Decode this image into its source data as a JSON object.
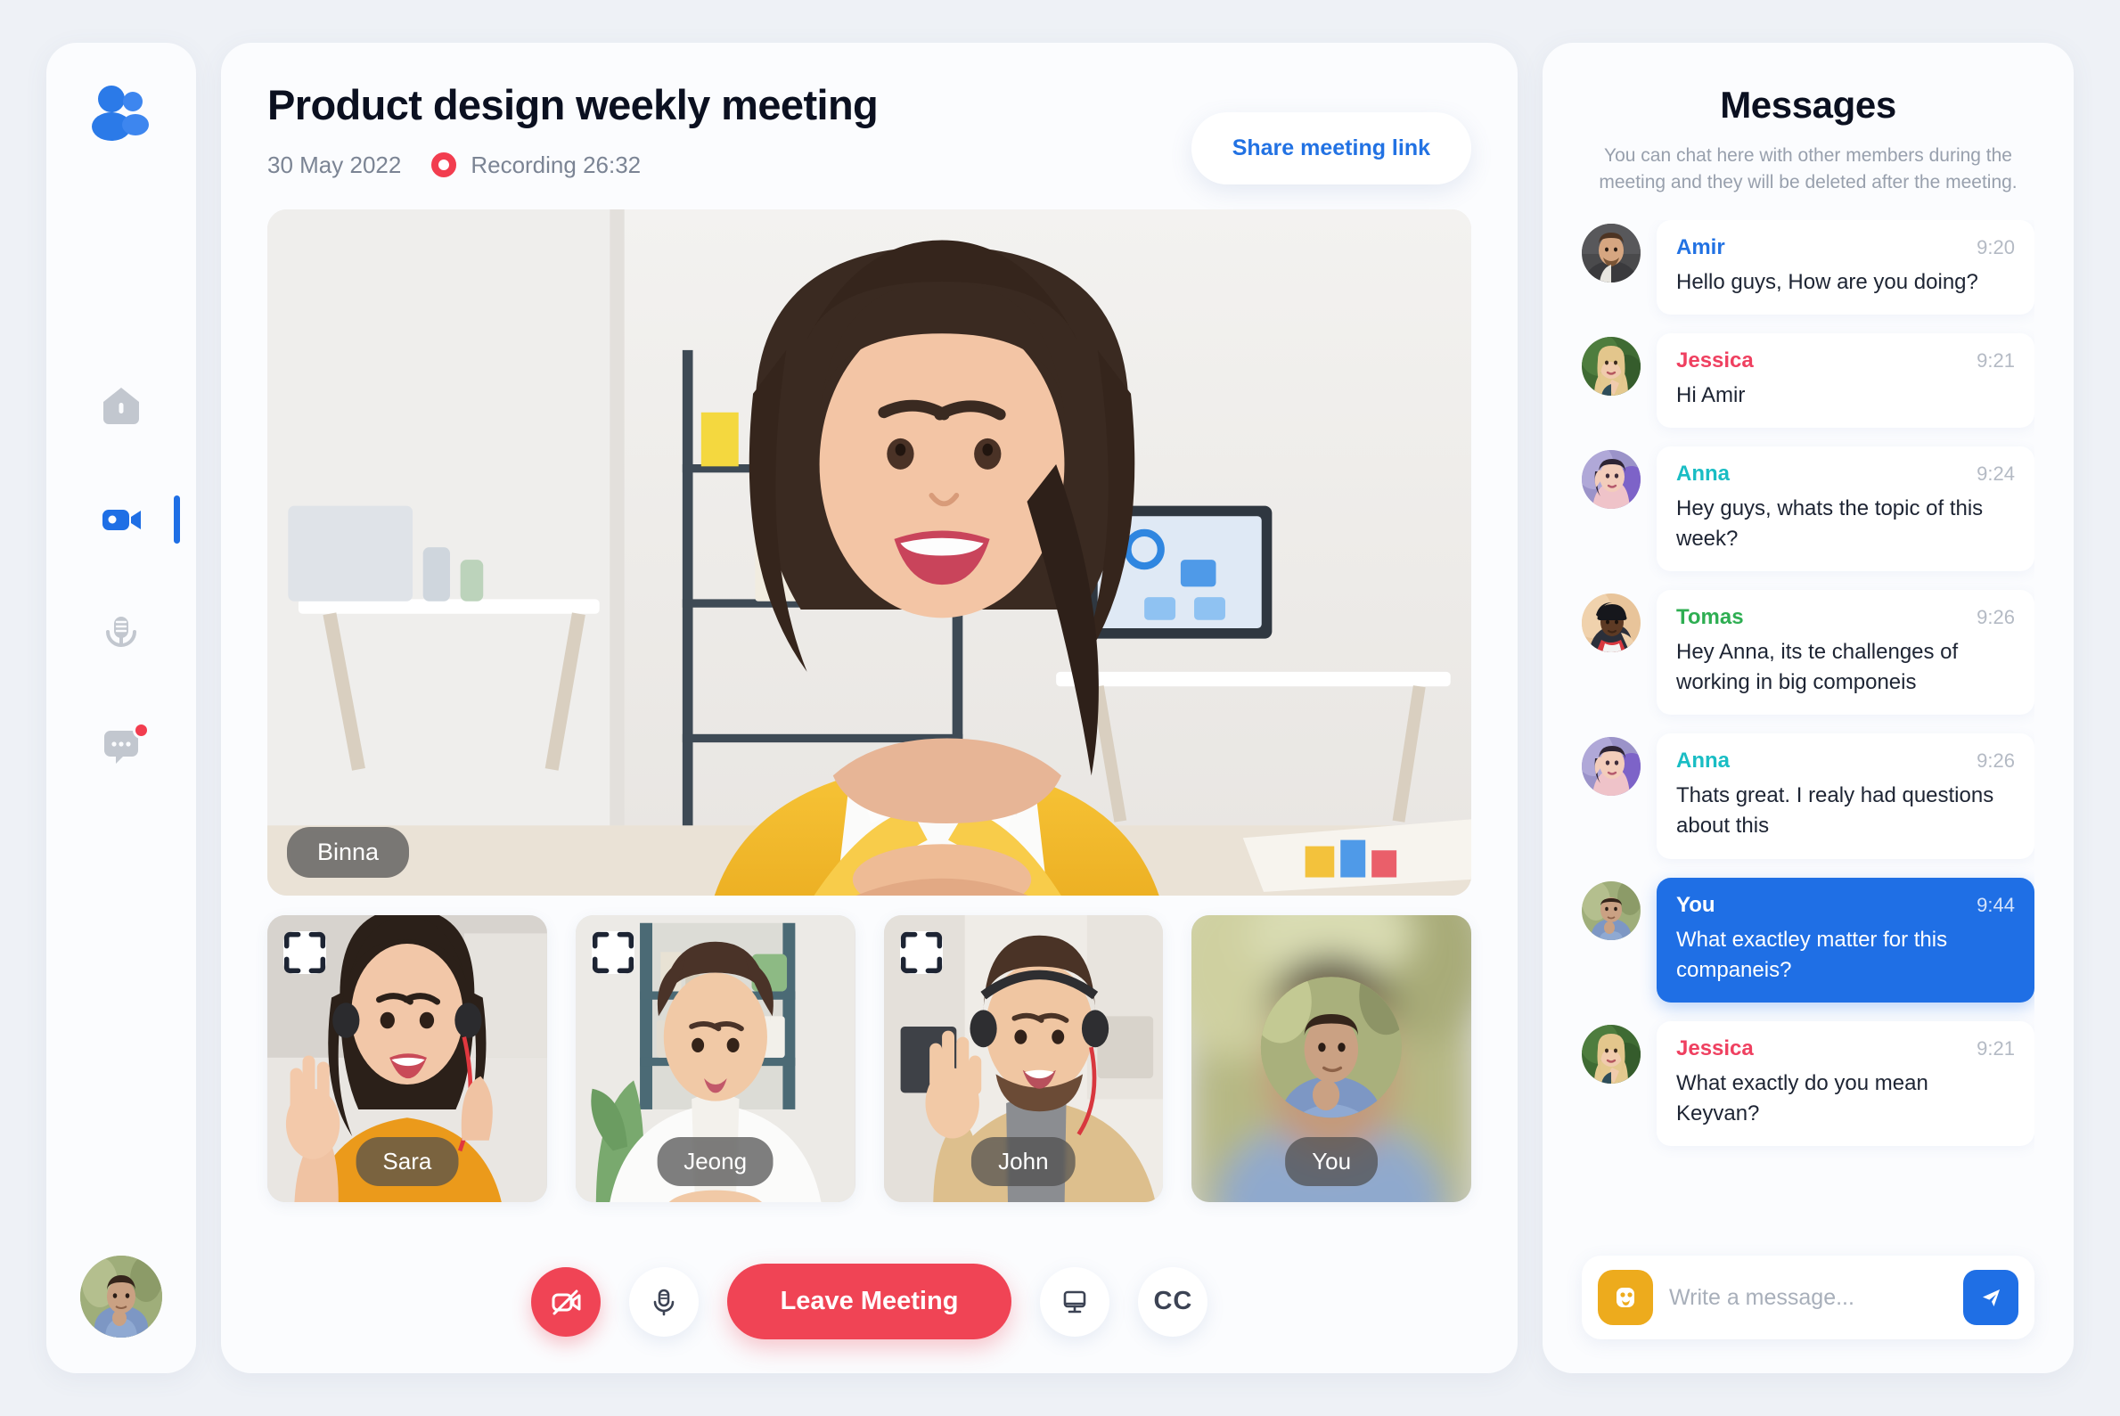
{
  "sidebar": {
    "logo_icon": "people-group-icon",
    "items": [
      {
        "icon": "home-icon",
        "name": "home",
        "active": false,
        "badge": false
      },
      {
        "icon": "video-camera-icon",
        "name": "meetings",
        "active": true,
        "badge": false
      },
      {
        "icon": "microphone-icon",
        "name": "audio",
        "active": false,
        "badge": false
      },
      {
        "icon": "chat-bubble-icon",
        "name": "messages",
        "active": false,
        "badge": true
      }
    ],
    "avatar": {
      "name": "user-avatar"
    }
  },
  "meeting": {
    "title": "Product design weekly meeting",
    "date": "30 May 2022",
    "recording_label": "Recording 26:32",
    "recording_icon": "record-dot-icon",
    "share_label": "Share meeting link",
    "stage": {
      "speaker": "Binna"
    },
    "participants": [
      {
        "name": "Sara",
        "expandable": true,
        "camera_on": true
      },
      {
        "name": "Jeong",
        "expandable": true,
        "camera_on": true
      },
      {
        "name": "John",
        "expandable": true,
        "camera_on": true
      },
      {
        "name": "You",
        "expandable": false,
        "camera_on": false
      }
    ],
    "controls": {
      "camera": {
        "icon": "camera-off-icon",
        "state": "off"
      },
      "mic": {
        "icon": "microphone-icon",
        "state": "on"
      },
      "leave_label": "Leave Meeting",
      "screen": {
        "icon": "screen-share-icon"
      },
      "captions_label": "CC"
    }
  },
  "chat": {
    "title": "Messages",
    "subtitle": "You can chat here with other members during the meeting and they will be deleted after the meeting.",
    "messages": [
      {
        "sender": "Amir",
        "time": "9:20",
        "text": "Hello guys, How are you doing?",
        "self": false,
        "color": "#2272e3"
      },
      {
        "sender": "Jessica",
        "time": "9:21",
        "text": "Hi Amir",
        "self": false,
        "color": "#ef4060"
      },
      {
        "sender": "Anna",
        "time": "9:24",
        "text": "Hey guys, whats the topic of this week?",
        "self": false,
        "color": "#19bdc4"
      },
      {
        "sender": "Tomas",
        "time": "9:26",
        "text": "Hey Anna, its te challenges of working in big componeis",
        "self": false,
        "color": "#2eae52"
      },
      {
        "sender": "Anna",
        "time": "9:26",
        "text": "Thats great. I realy had questions about this",
        "self": false,
        "color": "#19bdc4"
      },
      {
        "sender": "You",
        "time": "9:44",
        "text": "What exactley matter for this companeis?",
        "self": true,
        "color": "#ffffff"
      },
      {
        "sender": "Jessica",
        "time": "9:21",
        "text": "What exactly do you mean Keyvan?",
        "self": false,
        "color": "#ef4060"
      }
    ],
    "composer": {
      "emoji_icon": "emoji-smiley-icon",
      "placeholder": "Write a message...",
      "value": "",
      "send_icon": "send-paper-plane-icon"
    }
  },
  "colors": {
    "accent_blue": "#1f6fe5",
    "danger_red": "#f04455",
    "record_red": "#f23d4f",
    "emoji_yellow": "#edab1d",
    "panel_bg": "#fbfcfe",
    "page_bg": "#eef1f6"
  }
}
